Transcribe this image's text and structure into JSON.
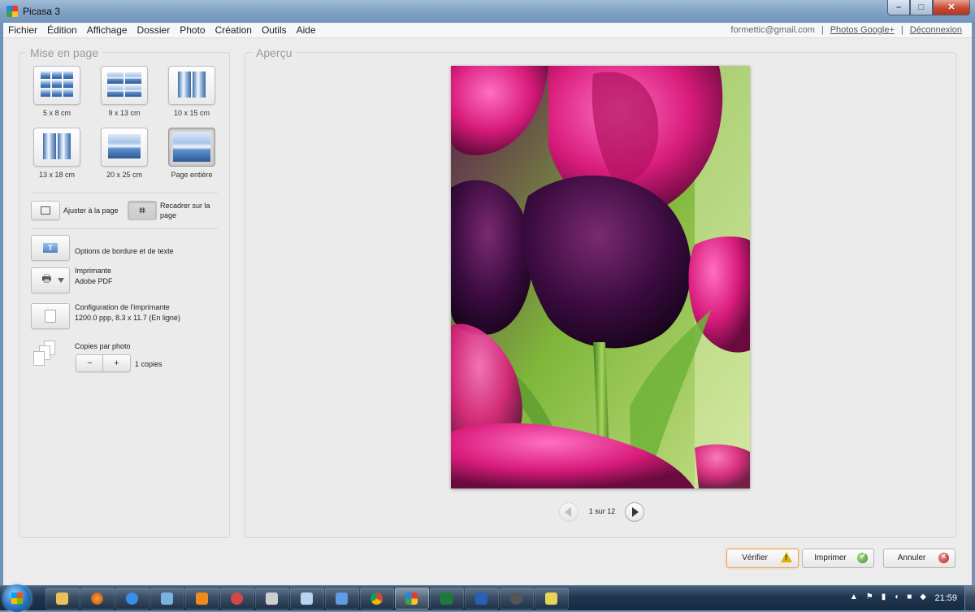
{
  "window": {
    "title": "Picasa 3"
  },
  "menu": {
    "items": [
      "Fichier",
      "Édition",
      "Affichage",
      "Dossier",
      "Photo",
      "Création",
      "Outils",
      "Aide"
    ],
    "account_email": "formettic@gmail.com",
    "photos_link": "Photos Google+",
    "logout_link": "Déconnexion"
  },
  "layout_panel": {
    "title": "Mise en page",
    "sizes": [
      "5 x 8 cm",
      "9 x 13 cm",
      "10 x 15 cm",
      "13 x 18 cm",
      "20 x 25 cm",
      "Page entière"
    ],
    "selected_size": "Page entière",
    "fit_label": "Ajuster à la page",
    "crop_label": "Recadrer sur la page",
    "border_text_label": "Options de bordure et de texte",
    "printer": {
      "label": "Imprimante",
      "value": "Adobe PDF"
    },
    "printer_config": {
      "label": "Configuration de l'imprimante",
      "value": "1200.0 ppp, 8.3 x 11.7 (En ligne)"
    },
    "copies": {
      "label": "Copies par photo",
      "minus": "−",
      "plus": "+",
      "value": "1 copies"
    }
  },
  "preview_panel": {
    "title": "Aperçu",
    "pager_text": "1 sur 12"
  },
  "actions": {
    "verify": "Vérifier",
    "print": "Imprimer",
    "cancel": "Annuler"
  },
  "taskbar": {
    "clock": "21:59"
  },
  "colors": {
    "accent_orange": "#e8a45a",
    "taskbar": "#1f3650",
    "photo_magenta": "#d81b7a",
    "photo_purple": "#3a0b3f",
    "photo_green": "#7bbf3a"
  }
}
